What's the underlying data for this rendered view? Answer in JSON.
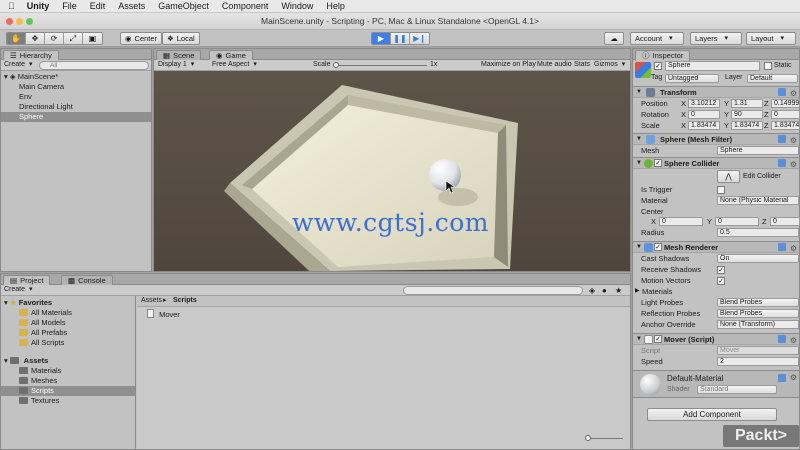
{
  "menubar": {
    "app": "Unity",
    "items": [
      "File",
      "Edit",
      "Assets",
      "GameObject",
      "Component",
      "Window",
      "Help"
    ]
  },
  "window": {
    "title": "MainScene.unity - Scripting - PC, Mac & Linux Standalone <OpenGL 4.1>"
  },
  "toolbar": {
    "pivot": "Center",
    "space": "Local",
    "account": "Account",
    "layers": "Layers",
    "layout": "Layout"
  },
  "hierarchy": {
    "tab": "Hierarchy",
    "create": "Create",
    "search_placeholder": "All",
    "scene": "MainScene*",
    "items": [
      "Main Camera",
      "Env",
      "Directional Light",
      "Sphere"
    ],
    "selected_index": 3
  },
  "game_view": {
    "tabs": [
      "Scene",
      "Game"
    ],
    "active_tab": "Game",
    "display": "Display 1",
    "aspect": "Free Aspect",
    "scale_label": "Scale",
    "scale_value": "1x",
    "toggles": [
      "Maximize on Play",
      "Mute audio",
      "Stats",
      "Gizmos"
    ],
    "watermark": "www.cgtsj.com"
  },
  "project": {
    "tabs": [
      "Project",
      "Console"
    ],
    "create": "Create",
    "favorites_label": "Favorites",
    "favorites": [
      "All Materials",
      "All Models",
      "All Prefabs",
      "All Scripts"
    ],
    "assets_label": "Assets",
    "assets": [
      "Materials",
      "Meshes",
      "Scripts",
      "Textures"
    ],
    "selected_folder": "Scripts",
    "breadcrumb": [
      "Assets",
      "Scripts"
    ],
    "files": [
      "Mover"
    ]
  },
  "inspector": {
    "tab": "Inspector",
    "object_name": "Sphere",
    "static_label": "Static",
    "tag_label": "Tag",
    "tag": "Untagged",
    "layer_label": "Layer",
    "layer": "Default",
    "transform": {
      "title": "Transform",
      "position_label": "Position",
      "rotation_label": "Rotation",
      "scale_label": "Scale",
      "position": [
        "3.10212",
        "1.31",
        "0.14999"
      ],
      "rotation": [
        "0",
        "90",
        "0"
      ],
      "scale": [
        "1.83474",
        "1.83474",
        "1.83474"
      ]
    },
    "mesh_filter": {
      "title": "Sphere (Mesh Filter)",
      "mesh_label": "Mesh",
      "mesh": "Sphere"
    },
    "sphere_collider": {
      "title": "Sphere Collider",
      "edit_label": "Edit Collider",
      "is_trigger_label": "Is Trigger",
      "material_label": "Material",
      "material": "None (Physic Material",
      "center_label": "Center",
      "center": [
        "0",
        "0",
        "0"
      ],
      "radius_label": "Radius",
      "radius": "0.5"
    },
    "mesh_renderer": {
      "title": "Mesh Renderer",
      "cast_shadows_label": "Cast Shadows",
      "cast_shadows": "On",
      "receive_shadows_label": "Receive Shadows",
      "motion_vectors_label": "Motion Vectors",
      "materials_label": "Materials",
      "light_probes_label": "Light Probes",
      "light_probes": "Blend Probes",
      "reflection_probes_label": "Reflection Probes",
      "reflection_probes": "Blend Probes",
      "anchor_label": "Anchor Override",
      "anchor": "None (Transform)"
    },
    "mover": {
      "title": "Mover (Script)",
      "script_label": "Script",
      "script": "Mover",
      "speed_label": "Speed",
      "speed": "2"
    },
    "material": {
      "name": "Default-Material",
      "shader_label": "Shader",
      "shader": "Standard"
    },
    "add_component": "Add Component"
  },
  "branding": {
    "logo": "Packt>"
  },
  "colors": {
    "accent": "#3d80e2",
    "selection": "#8f8f8f",
    "panel": "#c2c2c2"
  }
}
